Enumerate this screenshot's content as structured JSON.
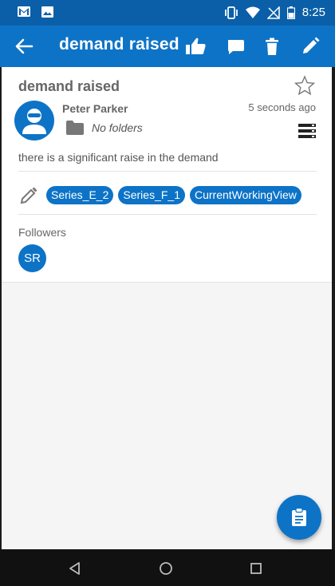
{
  "status_bar": {
    "time": "8:25",
    "left_icons": [
      "gmail-icon",
      "image-icon"
    ],
    "right_icons": [
      "vibrate-icon",
      "wifi-icon",
      "no-signal-icon",
      "battery-icon"
    ]
  },
  "app_bar": {
    "title": "demand raised",
    "actions": [
      "thumbs-up-icon",
      "comment-icon",
      "delete-icon",
      "edit-icon"
    ]
  },
  "discussion": {
    "subject": "demand raised",
    "author": "Peter Parker",
    "timestamp": "5 seconds ago",
    "folder": "No folders",
    "description": "there is a significant raise in the demand",
    "tags": [
      "Series_E_2",
      "Series_F_1",
      "CurrentWorkingView"
    ],
    "followers_label": "Followers",
    "followers": [
      "SR"
    ]
  },
  "colors": {
    "status_bar": "#0a5fa8",
    "app_bar": "#0d73c7",
    "accent": "#0d73c7",
    "background": "#f5f5f5"
  }
}
